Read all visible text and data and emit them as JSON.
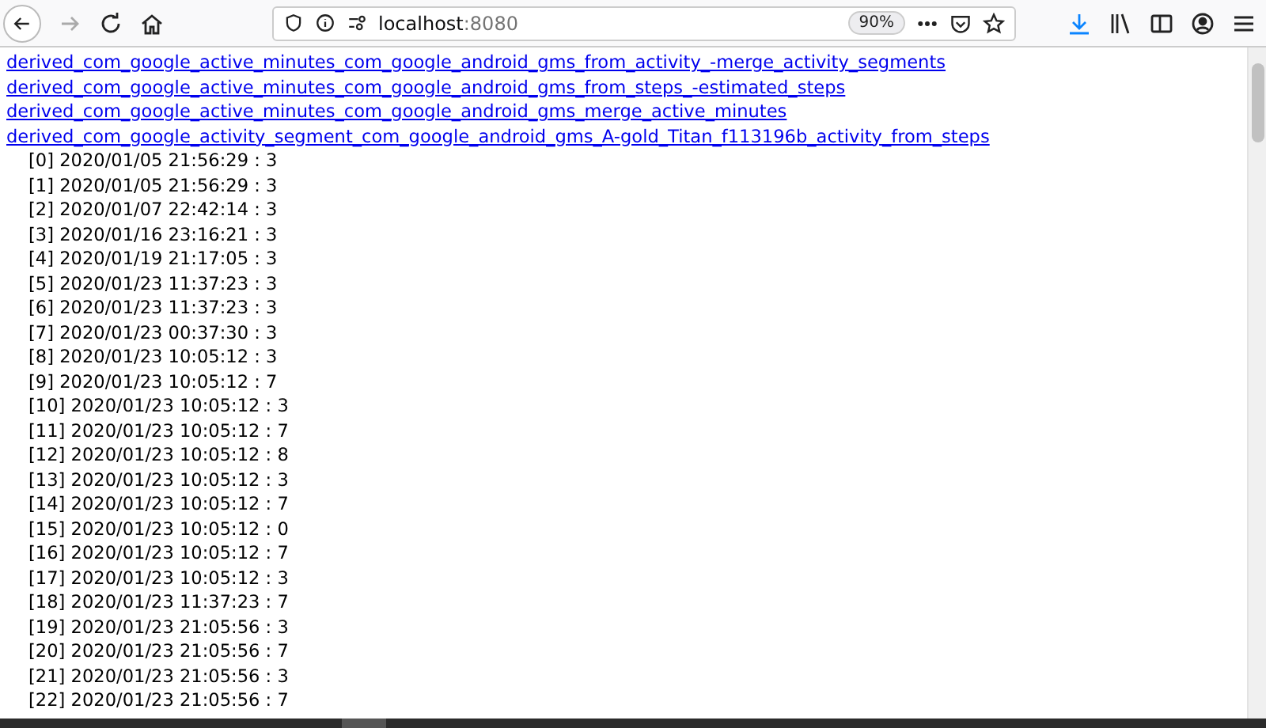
{
  "toolbar": {
    "url_host": "localhost",
    "url_port": ":8080",
    "zoom": "90%"
  },
  "links": [
    "derived_com_google_active_minutes_com_google_android_gms_from_activity_-merge_activity_segments",
    "derived_com_google_active_minutes_com_google_android_gms_from_steps_-estimated_steps",
    "derived_com_google_active_minutes_com_google_android_gms_merge_active_minutes",
    "derived_com_google_activity_segment_com_google_android_gms_A-gold_Titan_f113196b_activity_from_steps"
  ],
  "entries": [
    "[0] 2020/01/05 21:56:29 : 3",
    "[1] 2020/01/05 21:56:29 : 3",
    "[2] 2020/01/07 22:42:14 : 3",
    "[3] 2020/01/16 23:16:21 : 3",
    "[4] 2020/01/19 21:17:05 : 3",
    "[5] 2020/01/23 11:37:23 : 3",
    "[6] 2020/01/23 11:37:23 : 3",
    "[7] 2020/01/23 00:37:30 : 3",
    "[8] 2020/01/23 10:05:12 : 3",
    "[9] 2020/01/23 10:05:12 : 7",
    "[10] 2020/01/23 10:05:12 : 3",
    "[11] 2020/01/23 10:05:12 : 7",
    "[12] 2020/01/23 10:05:12 : 8",
    "[13] 2020/01/23 10:05:12 : 3",
    "[14] 2020/01/23 10:05:12 : 7",
    "[15] 2020/01/23 10:05:12 : 0",
    "[16] 2020/01/23 10:05:12 : 7",
    "[17] 2020/01/23 10:05:12 : 3",
    "[18] 2020/01/23 11:37:23 : 7",
    "[19] 2020/01/23 21:05:56 : 3",
    "[20] 2020/01/23 21:05:56 : 7",
    "[21] 2020/01/23 21:05:56 : 3",
    "[22] 2020/01/23 21:05:56 : 7"
  ]
}
